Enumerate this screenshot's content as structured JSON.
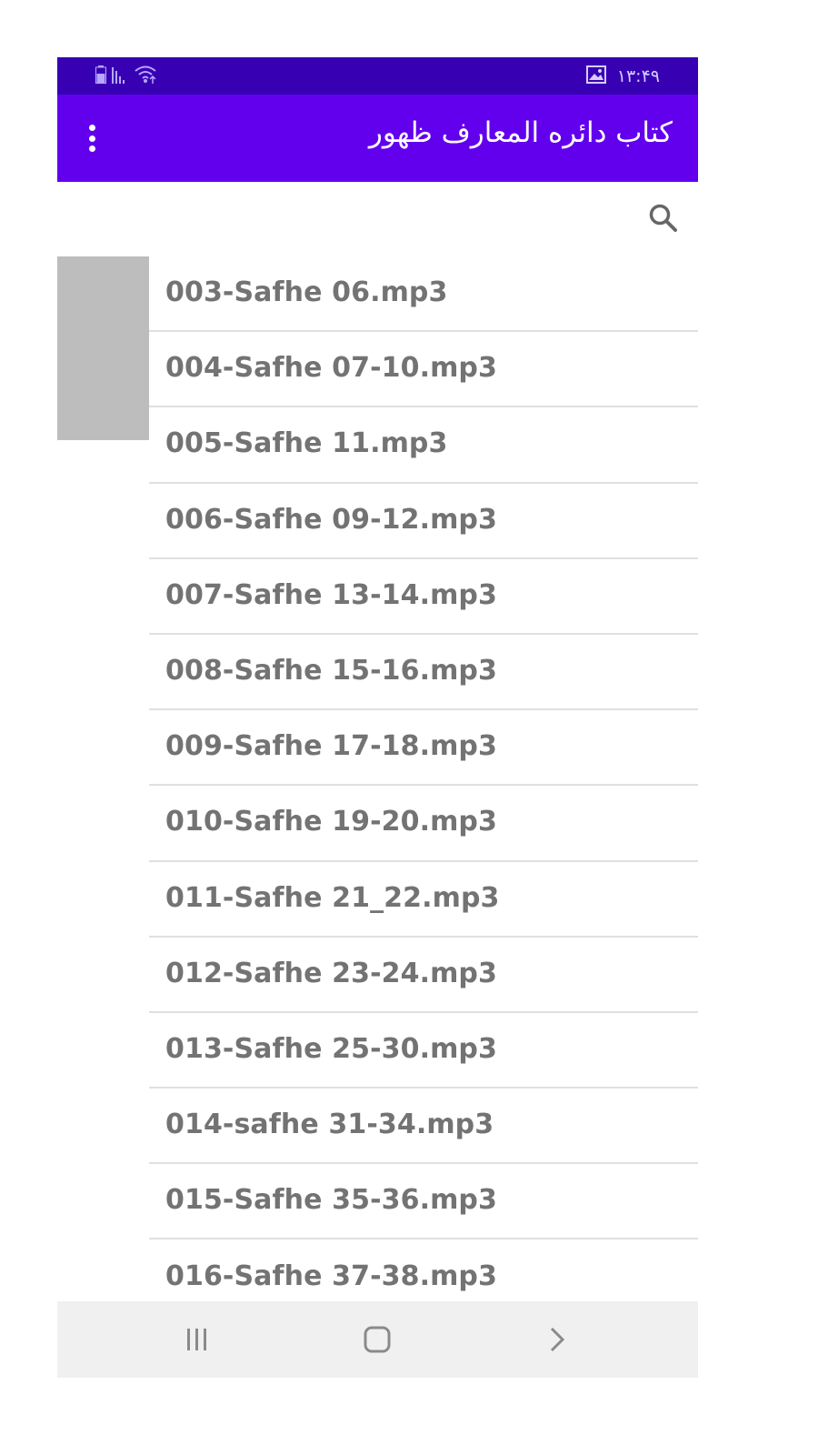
{
  "status_bar": {
    "time": "۱۳:۴۹",
    "icons": [
      "battery-icon",
      "signal-icon",
      "wifi-icon",
      "image-notification-icon"
    ]
  },
  "app_bar": {
    "title": "کتاب دائره المعارف ظهور",
    "menu_icon": "more-vert-icon"
  },
  "search": {
    "icon": "search-icon"
  },
  "files": [
    "003-Safhe 06.mp3",
    "004-Safhe 07-10.mp3",
    "005-Safhe 11.mp3",
    "006-Safhe 09-12.mp3",
    "007-Safhe 13-14.mp3",
    "008-Safhe 15-16.mp3",
    "009-Safhe 17-18.mp3",
    "010-Safhe 19-20.mp3",
    "011-Safhe 21_22.mp3",
    "012-Safhe 23-24.mp3",
    "013-Safhe 25-30.mp3",
    "014-safhe 31-34.mp3",
    "015-Safhe 35-36.mp3",
    "016-Safhe 37-38.mp3"
  ],
  "nav_bar": {
    "icons": [
      "recent-apps-icon",
      "home-icon",
      "back-icon"
    ]
  },
  "colors": {
    "status_bar": "#3700b3",
    "app_bar": "#6200ee",
    "text": "#737373",
    "divider": "#e0e0e0",
    "scroll_thumb": "#bdbdbd",
    "nav_bar": "#f0f0f0"
  }
}
